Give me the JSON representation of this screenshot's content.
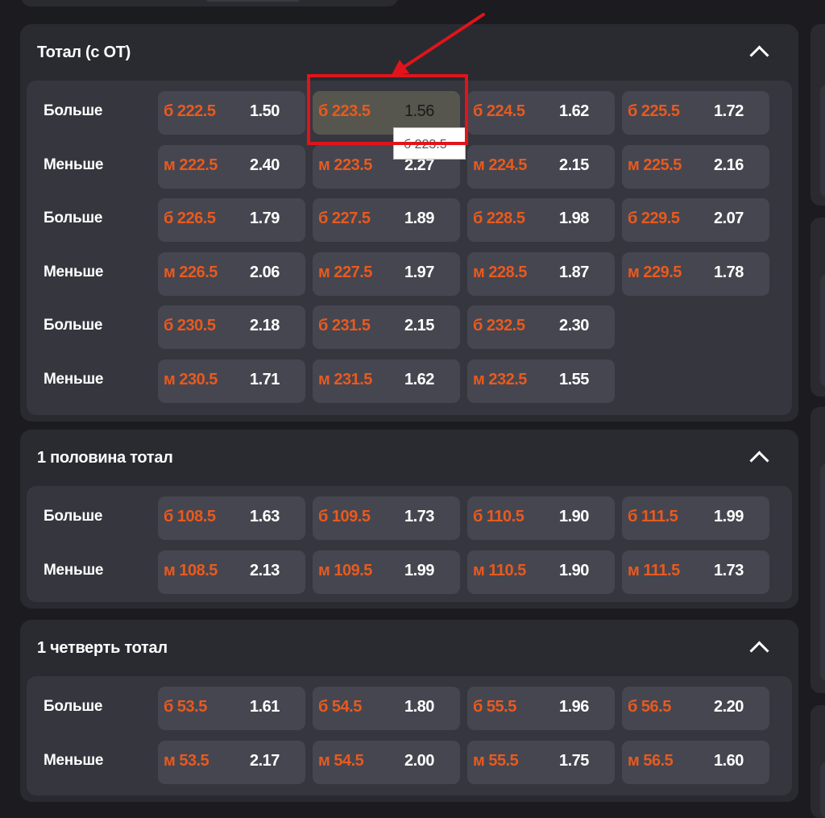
{
  "colors": {
    "line_accent": "#e85a1e",
    "annotation": "#e0141a"
  },
  "markets": [
    {
      "title": "Тотал (с ОТ)",
      "rows": [
        {
          "label": "Больше",
          "cells": [
            {
              "line": "б 222.5",
              "odds": "1.50"
            },
            {
              "line": "б 223.5",
              "odds": "1.56"
            },
            {
              "line": "б 224.5",
              "odds": "1.62"
            },
            {
              "line": "б 225.5",
              "odds": "1.72"
            }
          ]
        },
        {
          "label": "Меньше",
          "cells": [
            {
              "line": "м 222.5",
              "odds": "2.40"
            },
            {
              "line": "м 223.5",
              "odds": "2.27"
            },
            {
              "line": "м 224.5",
              "odds": "2.15"
            },
            {
              "line": "м 225.5",
              "odds": "2.16"
            }
          ]
        },
        {
          "label": "Больше",
          "cells": [
            {
              "line": "б 226.5",
              "odds": "1.79"
            },
            {
              "line": "б 227.5",
              "odds": "1.89"
            },
            {
              "line": "б 228.5",
              "odds": "1.98"
            },
            {
              "line": "б 229.5",
              "odds": "2.07"
            }
          ]
        },
        {
          "label": "Меньше",
          "cells": [
            {
              "line": "м 226.5",
              "odds": "2.06"
            },
            {
              "line": "м 227.5",
              "odds": "1.97"
            },
            {
              "line": "м 228.5",
              "odds": "1.87"
            },
            {
              "line": "м 229.5",
              "odds": "1.78"
            }
          ]
        },
        {
          "label": "Больше",
          "cells": [
            {
              "line": "б 230.5",
              "odds": "2.18"
            },
            {
              "line": "б 231.5",
              "odds": "2.15"
            },
            {
              "line": "б 232.5",
              "odds": "2.30"
            }
          ]
        },
        {
          "label": "Меньше",
          "cells": [
            {
              "line": "м 230.5",
              "odds": "1.71"
            },
            {
              "line": "м 231.5",
              "odds": "1.62"
            },
            {
              "line": "м 232.5",
              "odds": "1.55"
            }
          ]
        }
      ]
    },
    {
      "title": "1 половина тотал",
      "rows": [
        {
          "label": "Больше",
          "cells": [
            {
              "line": "б 108.5",
              "odds": "1.63"
            },
            {
              "line": "б 109.5",
              "odds": "1.73"
            },
            {
              "line": "б 110.5",
              "odds": "1.90"
            },
            {
              "line": "б 111.5",
              "odds": "1.99"
            }
          ]
        },
        {
          "label": "Меньше",
          "cells": [
            {
              "line": "м 108.5",
              "odds": "2.13"
            },
            {
              "line": "м 109.5",
              "odds": "1.99"
            },
            {
              "line": "м 110.5",
              "odds": "1.90"
            },
            {
              "line": "м 111.5",
              "odds": "1.73"
            }
          ]
        }
      ]
    },
    {
      "title": "1 четверть тотал",
      "rows": [
        {
          "label": "Больше",
          "cells": [
            {
              "line": "б 53.5",
              "odds": "1.61"
            },
            {
              "line": "б 54.5",
              "odds": "1.80"
            },
            {
              "line": "б 55.5",
              "odds": "1.96"
            },
            {
              "line": "б 56.5",
              "odds": "2.20"
            }
          ]
        },
        {
          "label": "Меньше",
          "cells": [
            {
              "line": "м 53.5",
              "odds": "2.17"
            },
            {
              "line": "м 54.5",
              "odds": "2.00"
            },
            {
              "line": "м 55.5",
              "odds": "1.75"
            },
            {
              "line": "м 56.5",
              "odds": "1.60"
            }
          ]
        }
      ]
    }
  ],
  "tooltip": {
    "text": "б 223.5"
  },
  "icons": {
    "collapse": "chevron-up-icon"
  }
}
